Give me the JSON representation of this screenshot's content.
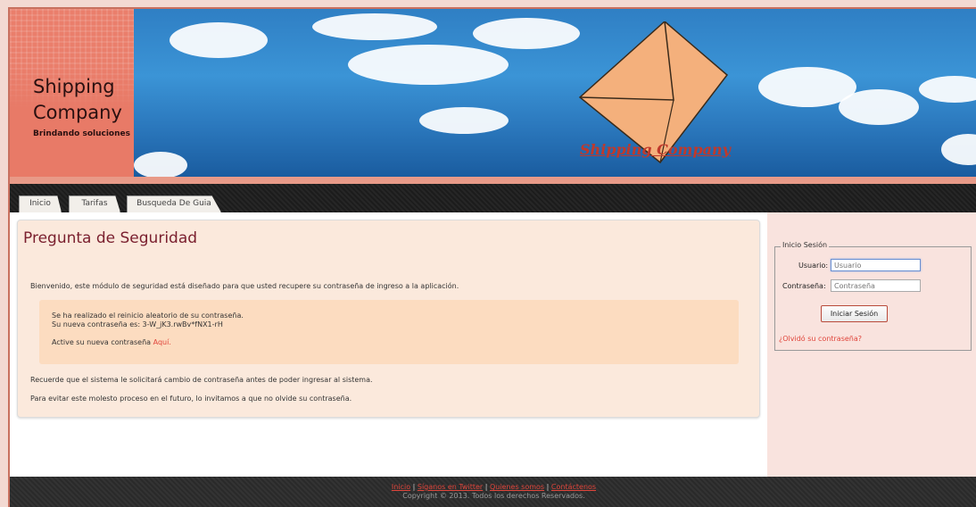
{
  "logo": {
    "line1": "Shipping",
    "line2": "Company",
    "tagline": "Brindando soluciones"
  },
  "banner": {
    "text": "Shipping Company"
  },
  "nav": {
    "tabs": [
      {
        "label": "Inicio"
      },
      {
        "label": "Tarifas"
      },
      {
        "label": "Busqueda De Guia"
      }
    ]
  },
  "main": {
    "title": "Pregunta de Seguridad",
    "intro": "Bienvenido, este módulo de seguridad está diseñado para que usted recupere su contraseña de ingreso a la aplicación.",
    "notice": {
      "line1": "Se ha realizado el reinicio aleatorio de su contraseña.",
      "line2": "Su nueva contraseña es: 3-W_jK3.rwBv*fNX1-rH",
      "line3_prefix": "Active su nueva contraseña",
      "line3_link": "Aquí."
    },
    "reminder1": "Recuerde que el sistema le solicitará cambio de contraseña antes de poder ingresar al sistema.",
    "reminder2": "Para evitar este molesto proceso en el futuro, lo invitamos a que no olvide su contraseña."
  },
  "login": {
    "legend": "Inicio Sesión",
    "user_label": "Usuario:",
    "user_placeholder": "Usuario",
    "pass_label": "Contraseña:",
    "pass_placeholder": "Contraseña",
    "submit": "Iniciar Sesión",
    "forgot": "¿Olvidó su contraseña?"
  },
  "footer": {
    "links": [
      "Inicio",
      "Síganos en Twitter",
      "Quienes somos",
      "Contáctenos"
    ],
    "copyright": "Copyright © 2013. Todos los derechos Reservados."
  },
  "colors": {
    "accent": "#ea7e6b",
    "title": "#7a1f2e",
    "link": "#e0453b"
  }
}
